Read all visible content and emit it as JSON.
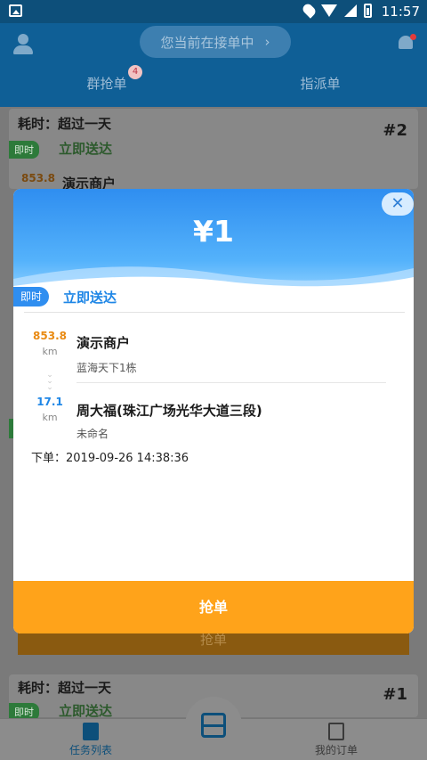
{
  "statusbar": {
    "time": "11:57"
  },
  "header": {
    "status_pill": "您当前在接单中",
    "pill_chevron": "›",
    "tabs": [
      {
        "label": "群抢单",
        "badge": "4"
      },
      {
        "label": "指派单"
      }
    ]
  },
  "background_cards": [
    {
      "elapsed": "耗时：超过一天",
      "number": "#2",
      "tag": "即时",
      "delivery": "立即送达",
      "distance": "853.8",
      "shop": "演示商户"
    },
    {
      "grab_label": "抢单"
    },
    {
      "elapsed": "耗时：超过一天",
      "number": "#1",
      "tag": "即时",
      "delivery": "立即送达"
    }
  ],
  "modal": {
    "price": "¥1",
    "close_glyph": "✕",
    "tag": "即时",
    "delivery": "立即送达",
    "from": {
      "distance": "853.8",
      "unit": "km",
      "name": "演示商户",
      "address": "蓝海天下1栋"
    },
    "to": {
      "distance": "17.1",
      "unit": "km",
      "name": "周大福(珠江广场光华大道三段)",
      "address": "未命名"
    },
    "order_time": "下单：2019-09-26 14:38:36",
    "grab_button": "抢单"
  },
  "bottom_nav": {
    "items": [
      {
        "label": "任务列表",
        "icon": "task-list-icon"
      },
      {
        "label": "",
        "icon": "scan-icon"
      },
      {
        "label": "我的订单",
        "icon": "my-orders-icon"
      }
    ]
  },
  "colors": {
    "primary": "#1e86e6",
    "accent": "#ffa31a",
    "distance_from": "#e98a12",
    "appbar": "#0f5f96"
  }
}
